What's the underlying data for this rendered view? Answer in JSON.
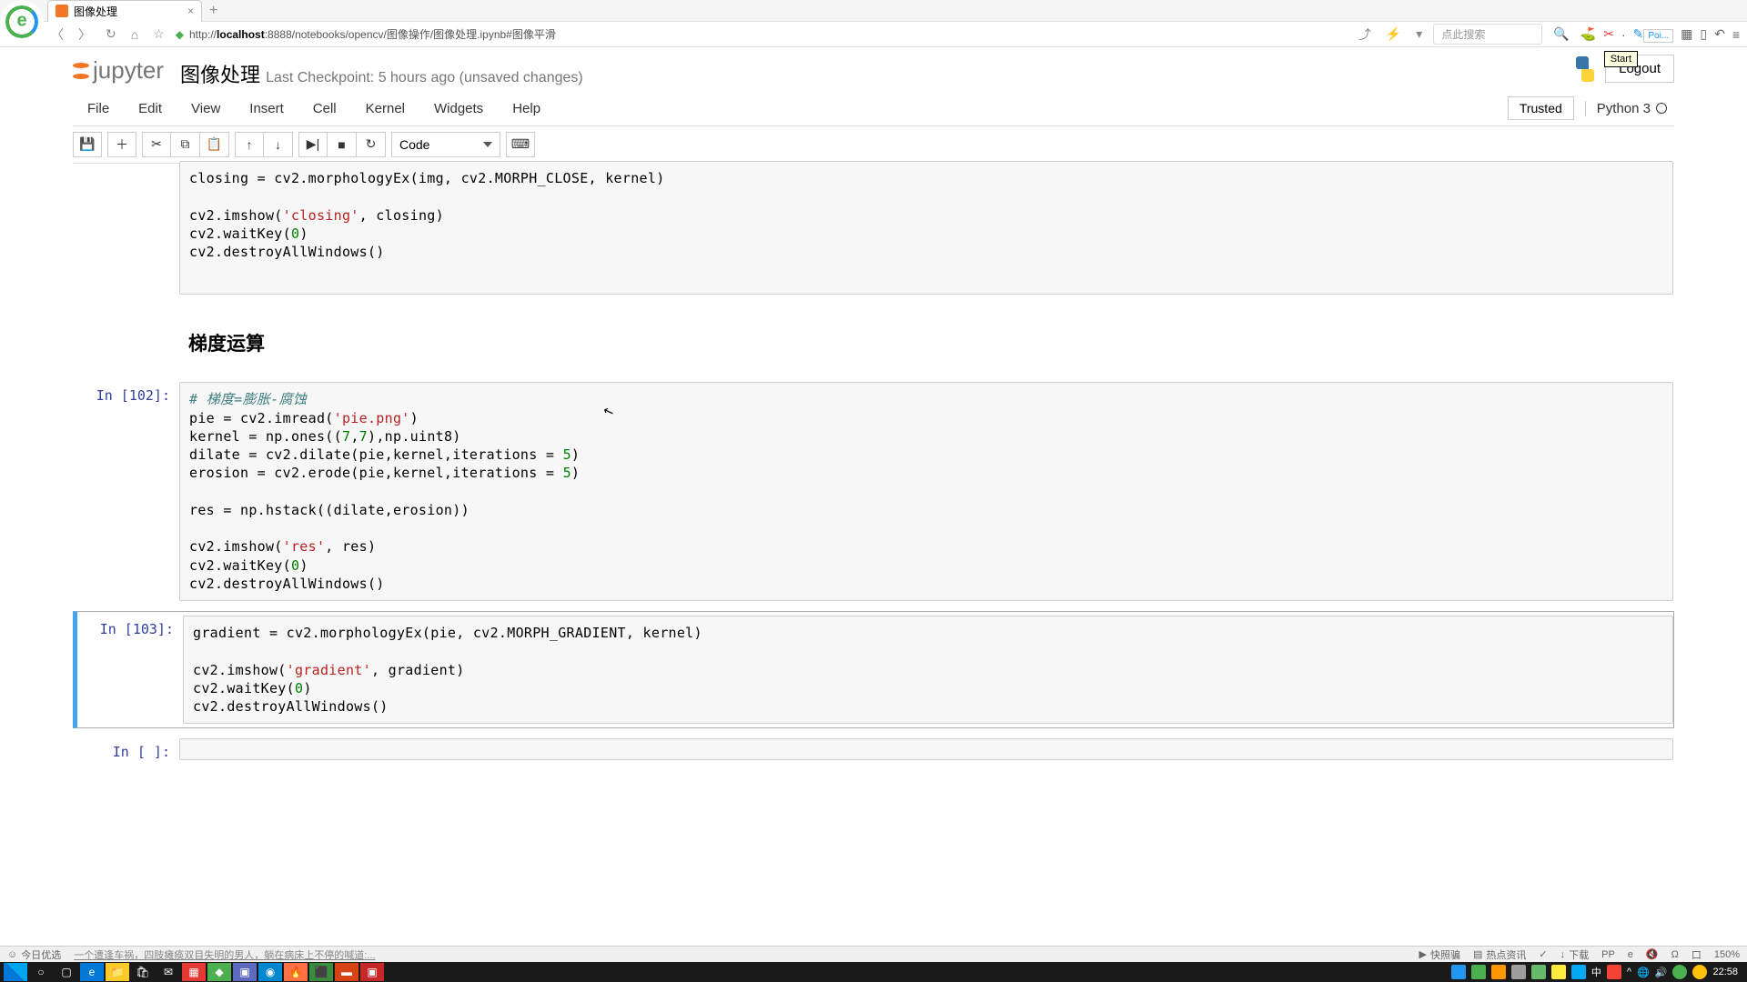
{
  "browser": {
    "tab_title": "图像处理",
    "url_host": "localhost",
    "url_port": ":8888",
    "url_path": "/notebooks/opencv/图像操作/图像处理.ipynb#图像平滑",
    "search_placeholder": "点此搜索",
    "picker_label": "Poi...",
    "start_tooltip": "Start"
  },
  "jupyter": {
    "logo_text": "jupyter",
    "title": "图像处理",
    "checkpoint": "Last Checkpoint: 5 hours ago (unsaved changes)",
    "logout": "Logout",
    "menu": [
      "File",
      "Edit",
      "View",
      "Insert",
      "Cell",
      "Kernel",
      "Widgets",
      "Help"
    ],
    "trusted": "Trusted",
    "kernel": "Python 3",
    "cell_type": "Code"
  },
  "cells": {
    "c0": {
      "prompt": "",
      "lines": [
        [
          {
            "t": "closing = cv2.morphologyEx(img, cv2.MORPH_CLOSE, kernel)"
          }
        ],
        [
          {
            "t": ""
          }
        ],
        [
          {
            "t": "cv2.imshow("
          },
          {
            "t": "'closing'",
            "c": "c-str"
          },
          {
            "t": ", closing)"
          }
        ],
        [
          {
            "t": "cv2.waitKey("
          },
          {
            "t": "0",
            "c": "c-num"
          },
          {
            "t": ")"
          }
        ],
        [
          {
            "t": "cv2.destroyAllWindows()"
          }
        ],
        [
          {
            "t": ""
          }
        ]
      ]
    },
    "md": {
      "heading": "梯度运算"
    },
    "c1": {
      "prompt": "In [102]:",
      "lines": [
        [
          {
            "t": "# 梯度=膨胀-腐蚀",
            "c": "c-cmt"
          }
        ],
        [
          {
            "t": "pie = cv2.imread("
          },
          {
            "t": "'pie.png'",
            "c": "c-str"
          },
          {
            "t": ")"
          }
        ],
        [
          {
            "t": "kernel = np.ones(("
          },
          {
            "t": "7",
            "c": "c-num"
          },
          {
            "t": ","
          },
          {
            "t": "7",
            "c": "c-num"
          },
          {
            "t": "),np.uint8)"
          }
        ],
        [
          {
            "t": "dilate = cv2.dilate(pie,kernel,iterations = "
          },
          {
            "t": "5",
            "c": "c-num"
          },
          {
            "t": ")"
          }
        ],
        [
          {
            "t": "erosion = cv2.erode(pie,kernel,iterations = "
          },
          {
            "t": "5",
            "c": "c-num"
          },
          {
            "t": ")"
          }
        ],
        [
          {
            "t": ""
          }
        ],
        [
          {
            "t": "res = np.hstack((dilate,erosion))"
          }
        ],
        [
          {
            "t": ""
          }
        ],
        [
          {
            "t": "cv2.imshow("
          },
          {
            "t": "'res'",
            "c": "c-str"
          },
          {
            "t": ", res)"
          }
        ],
        [
          {
            "t": "cv2.waitKey("
          },
          {
            "t": "0",
            "c": "c-num"
          },
          {
            "t": ")"
          }
        ],
        [
          {
            "t": "cv2.destroyAllWindows()"
          }
        ]
      ]
    },
    "c2": {
      "prompt": "In [103]:",
      "lines": [
        [
          {
            "t": "gradient = cv2.morphologyEx(pie, cv2.MORPH_GRADIENT, kernel)"
          }
        ],
        [
          {
            "t": ""
          }
        ],
        [
          {
            "t": "cv2.imshow("
          },
          {
            "t": "'gradient'",
            "c": "c-str"
          },
          {
            "t": ", gradient)"
          }
        ],
        [
          {
            "t": "cv2.waitKey("
          },
          {
            "t": "0",
            "c": "c-num"
          },
          {
            "t": ")"
          }
        ],
        [
          {
            "t": "cv2.destroyAllWindows()"
          }
        ]
      ]
    },
    "c3": {
      "prompt": "In [ ]:",
      "lines": [
        [
          {
            "t": ""
          }
        ]
      ]
    }
  },
  "statusbar": {
    "left1": "今日优选",
    "left2": "一个遭逢车祸，四肢瘫痪双目失明的男人，躺在病床上不停的喊道:...",
    "r1": "快照骗",
    "r2": "热点资讯",
    "r3": "✓",
    "r4": "下载",
    "r5": "PP",
    "r6": "e",
    "r7": "Ω",
    "r8": "口",
    "r9": "150%"
  },
  "taskbar": {
    "time": "22:58"
  }
}
